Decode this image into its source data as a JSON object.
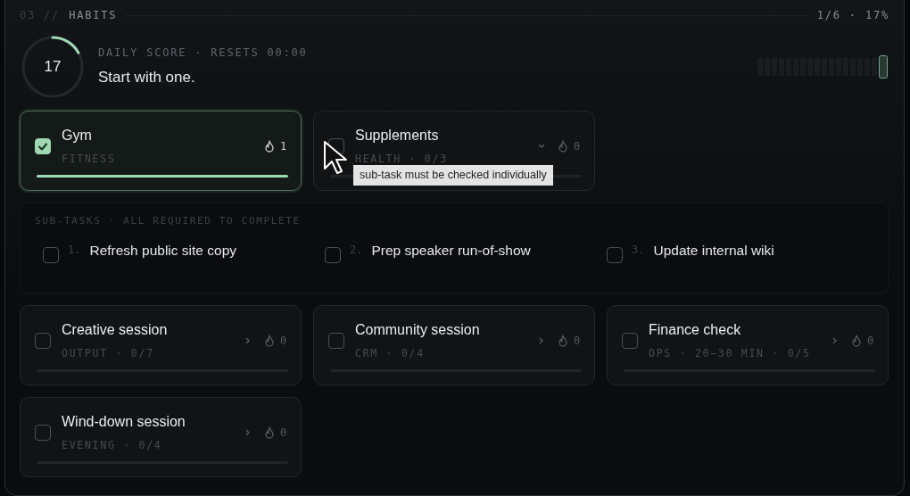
{
  "panel": {
    "index": "03 //",
    "title": "HABITS",
    "summary": "1/6 · 17%"
  },
  "score": {
    "value": "17",
    "level": 0.17,
    "label": "DAILY SCORE · RESETS 00:00",
    "message": "Start with one."
  },
  "habits": [
    {
      "name": "Gym",
      "meta": "FITNESS",
      "streak": "1",
      "checked": true,
      "level": 1,
      "expandable": false
    },
    {
      "name": "Supplements",
      "meta": "HEALTH · 0/3",
      "streak": "0",
      "checked": false,
      "level": 0,
      "expandable": true,
      "expanded": true,
      "tooltip": "sub-task must be checked individually"
    },
    {
      "name": "Creative session",
      "meta": "OUTPUT · 0/7",
      "streak": "0",
      "checked": false,
      "level": 0,
      "expandable": true,
      "expanded": false
    },
    {
      "name": "Community session",
      "meta": "CRM · 0/4",
      "streak": "0",
      "checked": false,
      "level": 0,
      "expandable": true,
      "expanded": false
    },
    {
      "name": "Finance check",
      "meta": "OPS · 20–30 MIN · 0/5",
      "streak": "0",
      "checked": false,
      "level": 0,
      "expandable": true,
      "expanded": false
    },
    {
      "name": "Wind-down session",
      "meta": "EVENING · 0/4",
      "streak": "0",
      "checked": false,
      "level": 0,
      "expandable": true,
      "expanded": false
    }
  ],
  "subtasks": {
    "title": "SUB-TASKS · ALL REQUIRED TO COMPLETE",
    "items": [
      {
        "number": "1.",
        "label": "Refresh public site copy",
        "checked": false
      },
      {
        "number": "2.",
        "label": "Prep speaker run-of-show",
        "checked": false
      },
      {
        "number": "3.",
        "label": "Update internal wiki",
        "checked": false
      }
    ]
  }
}
